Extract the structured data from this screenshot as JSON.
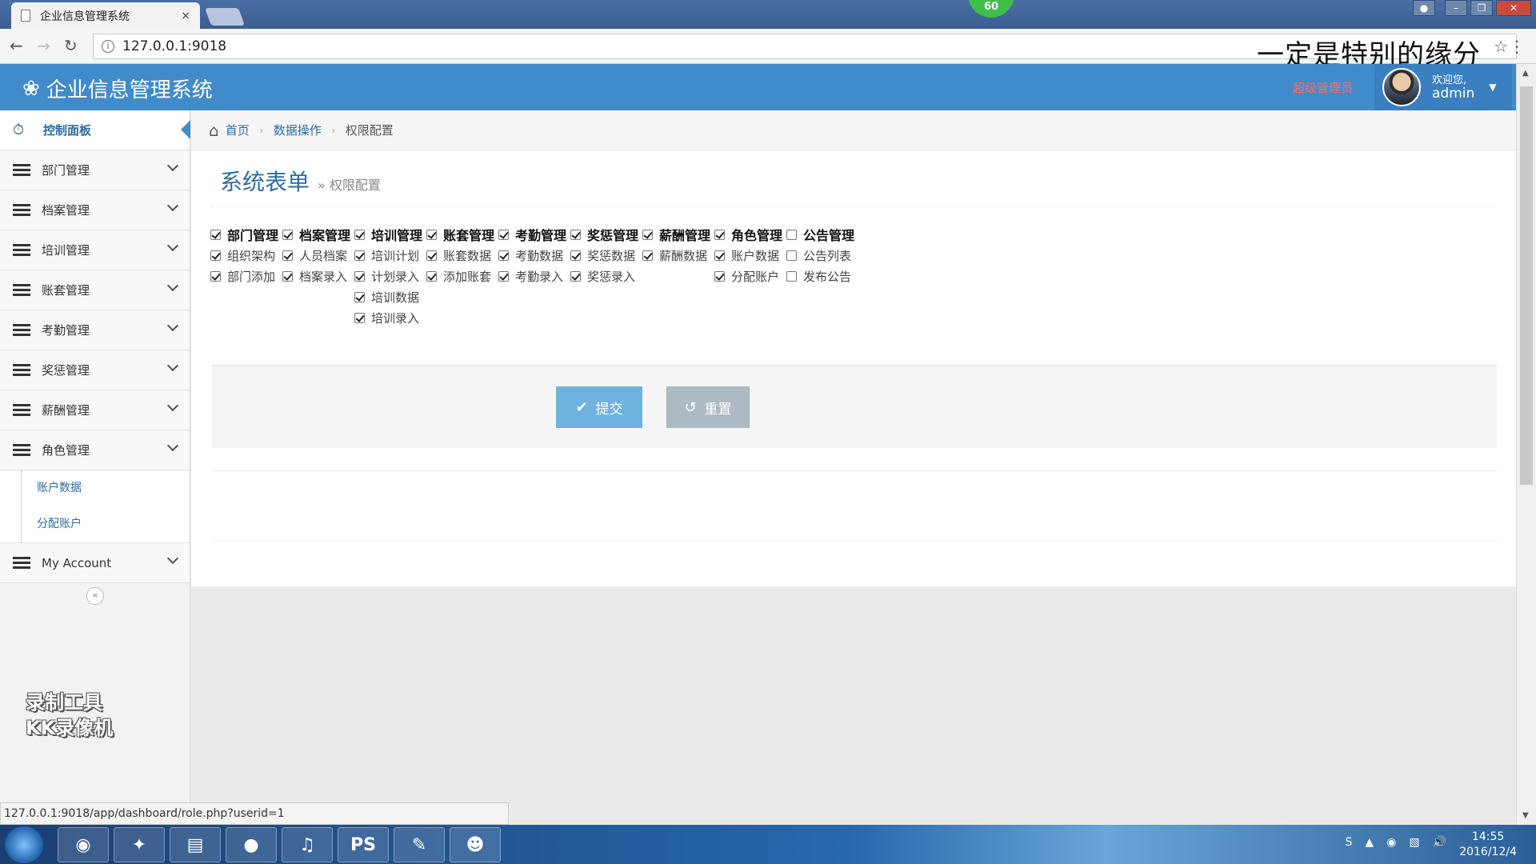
{
  "browser": {
    "tab_title": "企业信息管理系统",
    "tab_close": "×",
    "url": "127.0.0.1:9018",
    "overlay_caption": "一定是特别的缘分",
    "badge": "60",
    "status_url": "127.0.0.1:9018/app/dashboard/role.php?userid=1"
  },
  "header": {
    "app_title": "企业信息管理系统",
    "role_label": "超级管理员",
    "welcome": "欢迎您,",
    "username": "admin"
  },
  "sidebar": {
    "dashboard": "控制面板",
    "menus": [
      "部门管理",
      "档案管理",
      "培训管理",
      "账套管理",
      "考勤管理",
      "奖惩管理",
      "薪酬管理",
      "角色管理"
    ],
    "role_submenu": [
      "账户数据",
      "分配账户"
    ],
    "my_account": "My Account",
    "watermark_line1": "录制工具",
    "watermark_line2": "KK录像机"
  },
  "breadcrumb": {
    "home": "首页",
    "section": "数据操作",
    "current": "权限配置"
  },
  "page": {
    "title": "系统表单",
    "subtitle": "» 权限配置"
  },
  "permissions": [
    {
      "head": "部门管理",
      "head_checked": true,
      "items": [
        {
          "label": "组织架构",
          "checked": true
        },
        {
          "label": "部门添加",
          "checked": true
        }
      ]
    },
    {
      "head": "档案管理",
      "head_checked": true,
      "items": [
        {
          "label": "人员档案",
          "checked": true
        },
        {
          "label": "档案录入",
          "checked": true
        }
      ]
    },
    {
      "head": "培训管理",
      "head_checked": true,
      "items": [
        {
          "label": "培训计划",
          "checked": true
        },
        {
          "label": "计划录入",
          "checked": true
        },
        {
          "label": "培训数据",
          "checked": true
        },
        {
          "label": "培训录入",
          "checked": true
        }
      ]
    },
    {
      "head": "账套管理",
      "head_checked": true,
      "items": [
        {
          "label": "账套数据",
          "checked": true
        },
        {
          "label": "添加账套",
          "checked": true
        }
      ]
    },
    {
      "head": "考勤管理",
      "head_checked": true,
      "items": [
        {
          "label": "考勤数据",
          "checked": true
        },
        {
          "label": "考勤录入",
          "checked": true
        }
      ]
    },
    {
      "head": "奖惩管理",
      "head_checked": true,
      "items": [
        {
          "label": "奖惩数据",
          "checked": true
        },
        {
          "label": "奖惩录入",
          "checked": true
        }
      ]
    },
    {
      "head": "薪酬管理",
      "head_checked": true,
      "items": [
        {
          "label": "薪酬数据",
          "checked": true
        }
      ]
    },
    {
      "head": "角色管理",
      "head_checked": true,
      "items": [
        {
          "label": "账户数据",
          "checked": true
        },
        {
          "label": "分配账户",
          "checked": true
        }
      ]
    },
    {
      "head": "公告管理",
      "head_checked": false,
      "items": [
        {
          "label": "公告列表",
          "checked": false
        },
        {
          "label": "发布公告",
          "checked": false
        }
      ]
    }
  ],
  "actions": {
    "submit": "提交",
    "reset": "重置"
  },
  "taskbar": {
    "time": "14:55",
    "date": "2016/12/4",
    "apps": [
      "chrome-icon",
      "editor-icon",
      "folder-icon",
      "app-icon",
      "music-icon",
      "PS",
      "tool-icon",
      "game-icon"
    ]
  }
}
